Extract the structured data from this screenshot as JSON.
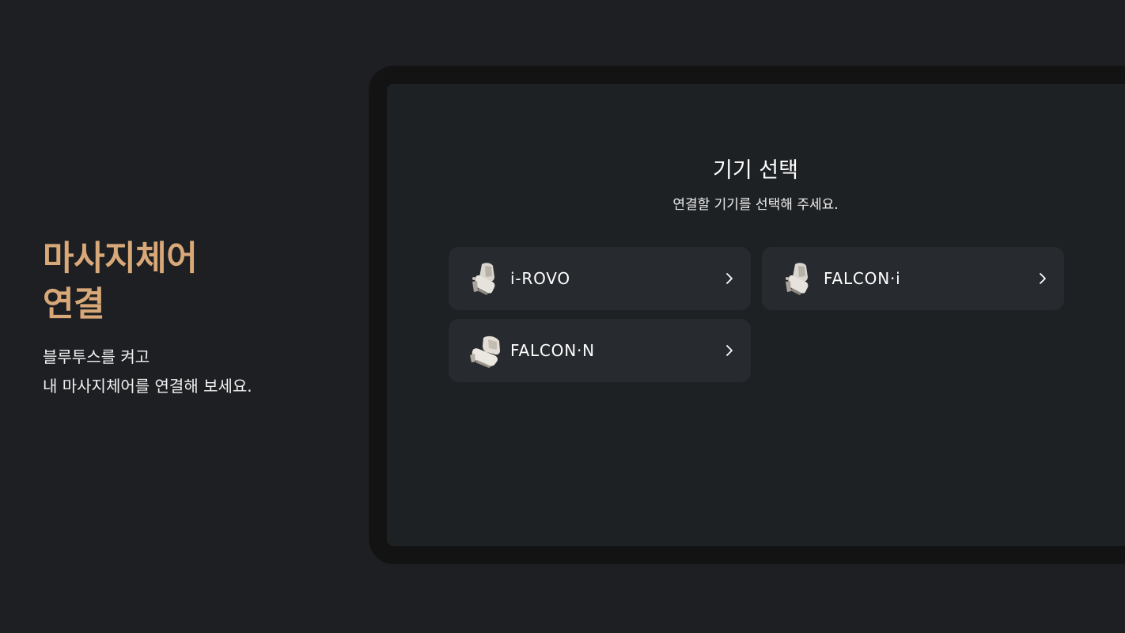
{
  "hero": {
    "title_line1": "마사지체어",
    "title_line2": "연결",
    "desc_line1": "블루투스를 켜고",
    "desc_line2": "내 마사지체어를 연결해 보세요."
  },
  "screen": {
    "title": "기기 선택",
    "subtitle": "연결할 기기를 선택해 주세요."
  },
  "devices": [
    {
      "name": "i-ROVO",
      "icon": "massage-chair-icon"
    },
    {
      "name": "FALCON·i",
      "icon": "massage-chair-icon"
    },
    {
      "name": "FALCON·N",
      "icon": "massage-chair-icon"
    }
  ],
  "colors": {
    "background": "#1d1f22",
    "accent": "#d8a878",
    "card": "#272a2e",
    "tablet_bezel": "#131313",
    "tablet_screen": "#1e2124"
  }
}
